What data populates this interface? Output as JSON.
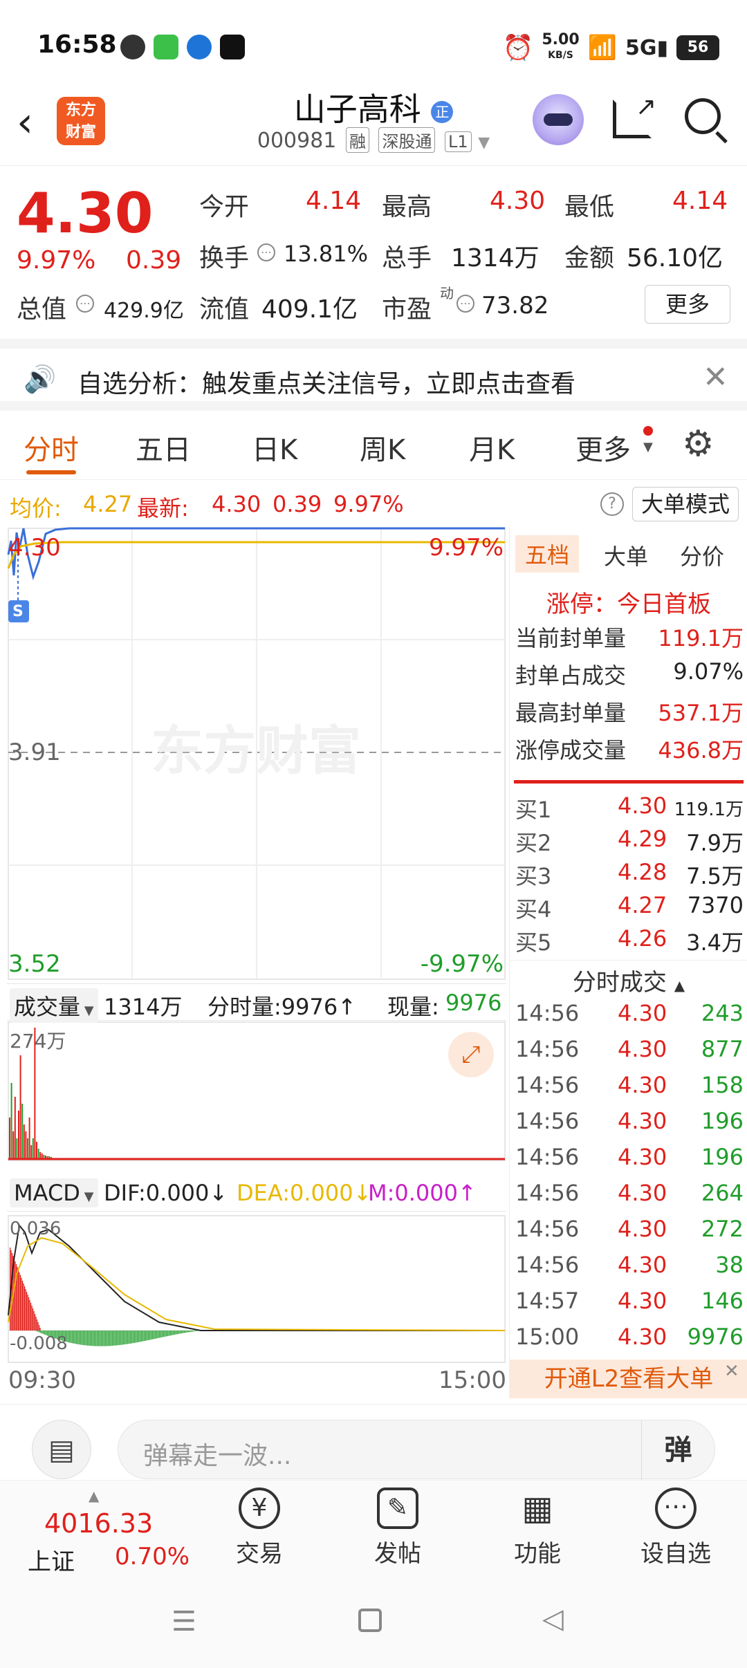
{
  "status_bar": {
    "time": "16:58",
    "net_speed_value": "5.00",
    "net_speed_unit": "KB/S",
    "battery": "56"
  },
  "header": {
    "logo_text_1": "东方",
    "logo_text_2": "财富",
    "stock_name": "山子高科",
    "stock_code": "000981",
    "tags": [
      "融",
      "深股通",
      "L1"
    ]
  },
  "quote": {
    "price": "4.30",
    "change_pct": "9.97%",
    "change": "0.39",
    "open_label": "今开",
    "open": "4.14",
    "high_label": "最高",
    "high": "4.30",
    "low_label": "最低",
    "low": "4.14",
    "turnover_label": "换手",
    "turnover": "13.81%",
    "volume_label": "总手",
    "volume": "1314万",
    "amount_label": "金额",
    "amount": "56.10亿",
    "mktcap_label": "总值",
    "mktcap": "429.9亿",
    "float_label": "流值",
    "float": "409.1亿",
    "pe_label": "市盈",
    "pe_super": "动",
    "pe": "73.82",
    "more": "更多"
  },
  "banner": {
    "text": "自选分析：触发重点关注信号，立即点击查看"
  },
  "tabs": [
    "分时",
    "五日",
    "日K",
    "周K",
    "月K",
    "更多"
  ],
  "infoline": {
    "avg_label": "均价:",
    "avg": "4.27",
    "latest_label": "最新:",
    "latest": "4.30",
    "change": "0.39",
    "pct": "9.97%",
    "mode_button": "大单模式"
  },
  "chart": {
    "price_top": "4.30",
    "pct_top": "9.97%",
    "price_mid": "3.91",
    "price_bottom": "3.52",
    "pct_bottom": "-9.97%",
    "s_marker": "S",
    "watermark": "东方财富",
    "vol_selector": "成交量",
    "vol_total": "1314万",
    "vol_fenshi": "分时量:9976↑",
    "vol_now_label": "现量:",
    "vol_now": "9976",
    "vol_max": "274万",
    "macd_selector": "MACD",
    "dif": "DIF:0.000↓",
    "dea": "DEA:0.000↓",
    "m": "M:0.000↑",
    "macd_top": "0.036",
    "macd_bottom": "-0.008",
    "time_start": "09:30",
    "time_end": "15:00",
    "colors": {
      "price_line": "#3a6fd8",
      "avg_line": "#e8b800",
      "up": "#e0201b",
      "down": "#1f9d2a"
    }
  },
  "right_panel": {
    "tabs": [
      "五档",
      "大单",
      "分价"
    ],
    "limit_title": "涨停：今日首板",
    "seal_stats": [
      {
        "label": "当前封单量",
        "value": "119.1万"
      },
      {
        "label": "封单占成交",
        "value": "9.07%"
      },
      {
        "label": "最高封单量",
        "value": "537.1万"
      },
      {
        "label": "涨停成交量",
        "value": "436.8万"
      }
    ],
    "bids": [
      {
        "label": "买1",
        "price": "4.30",
        "vol": "119.1万"
      },
      {
        "label": "买2",
        "price": "4.29",
        "vol": "7.9万"
      },
      {
        "label": "买3",
        "price": "4.28",
        "vol": "7.5万"
      },
      {
        "label": "买4",
        "price": "4.27",
        "vol": "7370"
      },
      {
        "label": "买5",
        "price": "4.26",
        "vol": "3.4万"
      }
    ],
    "trades_title": "分时成交",
    "trades": [
      {
        "time": "14:56",
        "price": "4.30",
        "vol": "243"
      },
      {
        "time": "14:56",
        "price": "4.30",
        "vol": "877"
      },
      {
        "time": "14:56",
        "price": "4.30",
        "vol": "158"
      },
      {
        "time": "14:56",
        "price": "4.30",
        "vol": "196"
      },
      {
        "time": "14:56",
        "price": "4.30",
        "vol": "196"
      },
      {
        "time": "14:56",
        "price": "4.30",
        "vol": "264"
      },
      {
        "time": "14:56",
        "price": "4.30",
        "vol": "272"
      },
      {
        "time": "14:56",
        "price": "4.30",
        "vol": "38"
      },
      {
        "time": "14:57",
        "price": "4.30",
        "vol": "146"
      },
      {
        "time": "15:00",
        "price": "4.30",
        "vol": "9976"
      }
    ],
    "l2_banner": "开通L2查看大单"
  },
  "input_bar": {
    "placeholder": "弹幕走一波...",
    "send_glyph": "弹"
  },
  "bottom_nav": {
    "index_value": "4016.33",
    "index_name": "上证",
    "index_pct": "0.70%",
    "items": [
      "交易",
      "发帖",
      "功能",
      "设自选"
    ]
  }
}
